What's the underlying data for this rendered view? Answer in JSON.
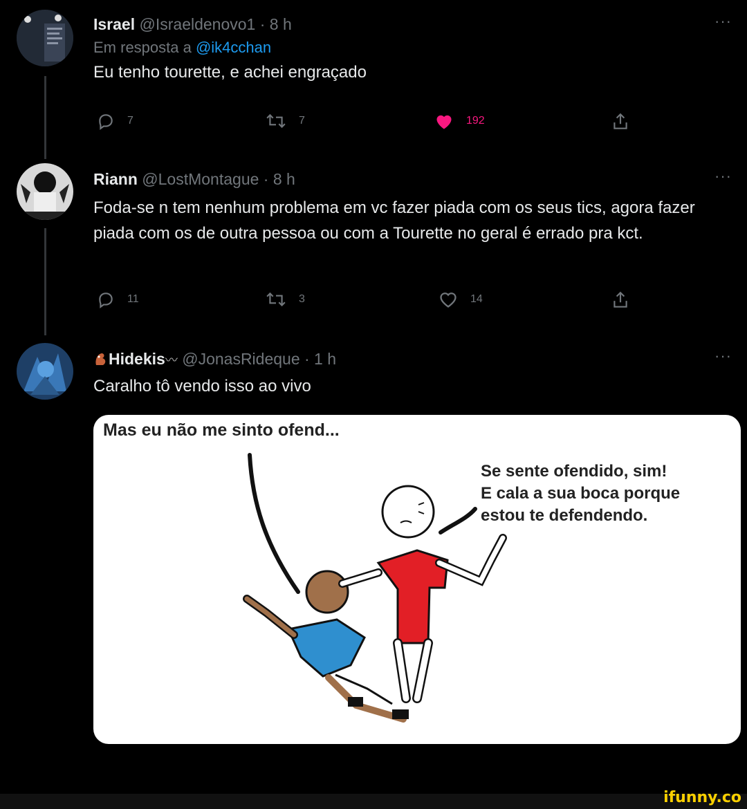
{
  "tweets": [
    {
      "name": "Israel",
      "handle": "@Israeldenovo1 · 8 h",
      "reply_prefix": "Em resposta a ",
      "reply_handle": "@ik4cchan",
      "text": "Eu tenho tourette, e achei engraçado",
      "replies": "7",
      "retweets": "7",
      "likes": "192",
      "liked": true
    },
    {
      "name": "Riann",
      "handle": "@LostMontague · 8 h",
      "text": "Foda-se n tem nenhum problema em vc fazer piada com os seus tics, agora fazer piada com os de outra pessoa ou com a Tourette no geral é errado pra kct.",
      "replies": "11",
      "retweets": "3",
      "likes": "14",
      "liked": false
    },
    {
      "name": "Hidekis",
      "handle": "@JonasRideque · 1 h",
      "text": "Caralho tô vendo isso ao vivo"
    }
  ],
  "more_label": "···",
  "meme": {
    "left_text": "Mas eu não me sinto ofend...",
    "right_lines": [
      "Se sente ofendido, sim!",
      "E cala a sua boca porque",
      "estou te defendendo."
    ]
  },
  "watermark": "ifunny.co",
  "colors": {
    "background": "#000000",
    "text": "#e7e9ea",
    "muted": "#71767b",
    "link": "#1d9bf0",
    "like": "#f91880",
    "watermark": "#fbd000"
  },
  "icons": [
    "reply-icon",
    "retweet-icon",
    "like-icon",
    "share-icon",
    "more-icon"
  ]
}
